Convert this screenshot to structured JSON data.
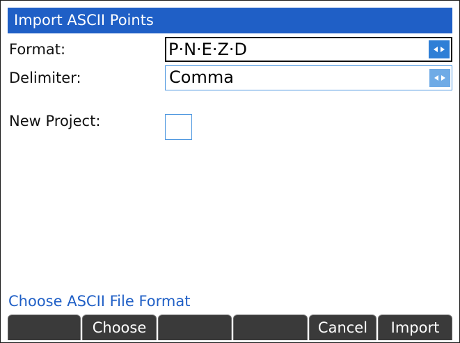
{
  "title": "Import ASCII Points",
  "form": {
    "format_label": "Format:",
    "format_value": "P·N·E·Z·D",
    "delimiter_label": "Delimiter:",
    "delimiter_value": "Comma",
    "new_project_label": "New Project:",
    "new_project_checked": false
  },
  "status_hint": "Choose ASCII File Format",
  "softkeys": [
    "",
    "Choose",
    "",
    "",
    "Cancel",
    "Import"
  ],
  "colors": {
    "title_bar": "#1f5fc6",
    "field_border": "#4f98e0",
    "hint_text": "#1f5fc6",
    "softkey_bg": "#3a3a3a"
  },
  "icons": {
    "choose_arrows": "left-right-arrows-icon"
  }
}
